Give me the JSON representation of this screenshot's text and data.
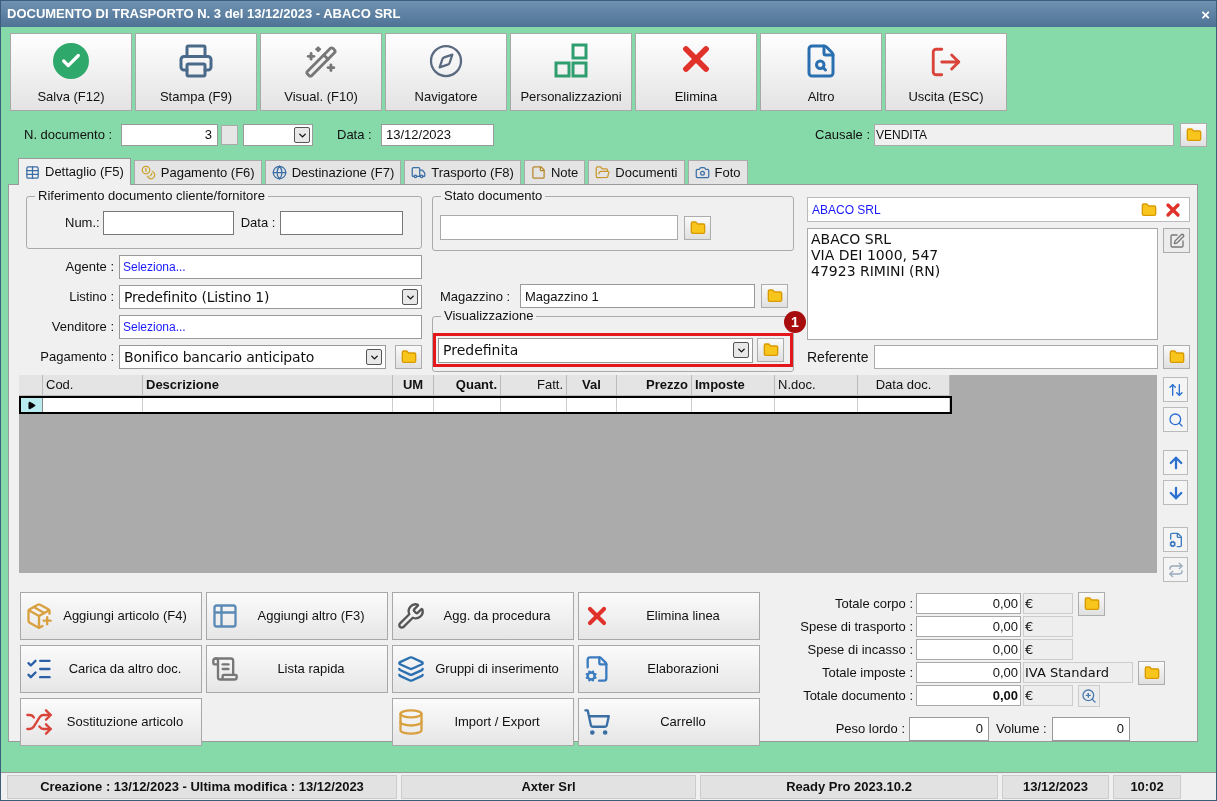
{
  "window": {
    "title": "DOCUMENTO DI TRASPORTO N. 3 del 13/12/2023 - ABACO SRL",
    "close": "×"
  },
  "toolbar": [
    {
      "label": "Salva (F12)",
      "kind": "check"
    },
    {
      "label": "Stampa (F9)",
      "kind": "printer"
    },
    {
      "label": "Visual. (F10)",
      "kind": "wand"
    },
    {
      "label": "Navigatore",
      "kind": "compass"
    },
    {
      "label": "Personalizzazioni",
      "kind": "squares"
    },
    {
      "label": "Elimina",
      "kind": "cross"
    },
    {
      "label": "Altro",
      "kind": "search"
    },
    {
      "label": "Uscita (ESC)",
      "kind": "exit"
    }
  ],
  "header": {
    "number_label": "N. documento :",
    "number": "3",
    "date_label": "Data :",
    "date": "13/12/2023",
    "causale_label": "Causale :",
    "causale": "VENDITA"
  },
  "tabs": [
    {
      "label": "Dettaglio (F5)",
      "kind": "table",
      "selected": true
    },
    {
      "label": "Pagamento (F6)",
      "kind": "coins",
      "selected": false
    },
    {
      "label": "Destinazione (F7)",
      "kind": "globe",
      "selected": false
    },
    {
      "label": "Trasporto (F8)",
      "kind": "truck",
      "selected": false
    },
    {
      "label": "Note",
      "kind": "note",
      "selected": false
    },
    {
      "label": "Documenti",
      "kind": "folder",
      "selected": false
    },
    {
      "label": "Foto",
      "kind": "camera",
      "selected": false
    }
  ],
  "riferimento": {
    "legend": "Riferimento documento cliente/fornitore",
    "num_label": "Num.:",
    "data_label": "Data :"
  },
  "stato": {
    "legend": "Stato documento"
  },
  "fields": [
    {
      "label": "Agente :",
      "kind": "link",
      "value": "Seleziona..."
    },
    {
      "label": "Listino :",
      "kind": "select",
      "value": "Predefinito (Listino 1)"
    },
    {
      "label": "Venditore :",
      "kind": "link",
      "value": "Seleziona..."
    },
    {
      "label": "Pagamento :",
      "kind": "select_folder",
      "value": "Bonifico bancario anticipato"
    }
  ],
  "magazzino": {
    "label": "Magazzino :",
    "value": "Magazzino 1"
  },
  "visualizzazione": {
    "legend": "Visualizzazione",
    "value": "Predefinita",
    "highlighted": true,
    "callout": "1"
  },
  "customer": {
    "name": "ABACO SRL",
    "address_lines": [
      "ABACO SRL",
      "VIA DEI 1000, 547",
      "47923 RIMINI (RN)"
    ],
    "referente_label": "Referente"
  },
  "grid": {
    "columns": [
      {
        "label": "Cod.",
        "bold": false
      },
      {
        "label": "Descrizione",
        "bold": true
      },
      {
        "label": "UM",
        "bold": true
      },
      {
        "label": "Quant.",
        "bold": true
      },
      {
        "label": "Fatt.",
        "bold": false
      },
      {
        "label": "Val",
        "bold": true
      },
      {
        "label": "Prezzo",
        "bold": true
      },
      {
        "label": "Imposte",
        "bold": true
      },
      {
        "label": "N.doc.",
        "bold": false
      },
      {
        "label": "Data doc.",
        "bold": false
      }
    ]
  },
  "actions": [
    {
      "label": "Aggiungi articolo (F4)",
      "kind": "box"
    },
    {
      "label": "Aggiungi altro (F3)",
      "kind": "table"
    },
    {
      "label": "Agg. da procedura",
      "kind": "wrench"
    },
    {
      "label": "Elimina linea",
      "kind": "cross"
    },
    {
      "label": "Carica da altro doc.",
      "kind": "checklist"
    },
    {
      "label": "Lista rapida",
      "kind": "scroll"
    },
    {
      "label": "Gruppi di inserimento",
      "kind": "layers"
    },
    {
      "label": "Elaborazioni",
      "kind": "filecog"
    },
    {
      "label": "Sostituzione articolo",
      "kind": "shuffle"
    },
    {
      "label": "Import / Export",
      "kind": "database"
    },
    {
      "label": "Carrello",
      "kind": "cart"
    }
  ],
  "totals": [
    {
      "label": "Totale corpo :",
      "value": "0,00",
      "unit": "€",
      "bold": false,
      "kind": "folder"
    },
    {
      "label": "Spese di trasporto :",
      "value": "0,00",
      "unit": "€",
      "bold": false,
      "kind": "plain"
    },
    {
      "label": "Spese di incasso :",
      "value": "0,00",
      "unit": "€",
      "bold": false,
      "kind": "plain"
    },
    {
      "label": "Totale imposte :",
      "value": "0,00",
      "unit": "IVA Standard",
      "bold": false,
      "kind": "folder"
    },
    {
      "label": "Totale documento :",
      "value": "0,00",
      "unit": "€",
      "bold": true,
      "kind": "zoom"
    }
  ],
  "peso": {
    "label": "Peso lordo :",
    "value": "0"
  },
  "volume": {
    "label": "Volume :",
    "value": "0"
  },
  "status_bar": [
    "Creazione : 13/12/2023 - Ultima modifica : 13/12/2023",
    "Axter Srl",
    "Ready Pro 2023.10.2",
    "13/12/2023",
    "10:02"
  ]
}
